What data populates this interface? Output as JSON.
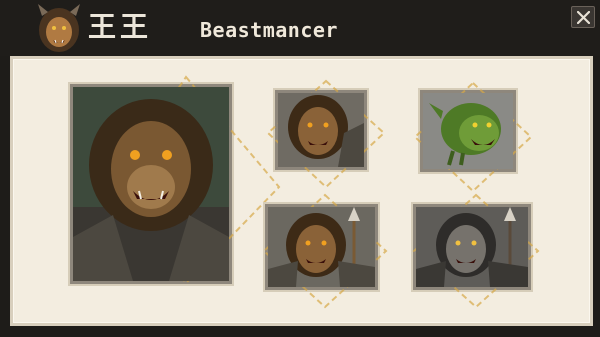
{
  "window": {
    "kanji": "王王",
    "title": "Beastmancer",
    "close_symbol": "✕"
  },
  "header_icon": "lion-warrior-portrait-icon",
  "cards": [
    {
      "name": "lion-warrior-large-portrait",
      "tint": "#3d4a3c",
      "fur": "#5a4126"
    },
    {
      "name": "lion-warrior-portrait",
      "tint": "#6f6b63",
      "fur": "#5b3f24"
    },
    {
      "name": "green-beast-portrait",
      "tint": "#8a8a86",
      "fur": "#5c8a2e"
    },
    {
      "name": "lion-spearman-portrait",
      "tint": "#6b6860",
      "fur": "#6a4a28"
    },
    {
      "name": "grey-wolf-spearman-portrait",
      "tint": "#5e5c58",
      "fur": "#55524f"
    }
  ],
  "colors": {
    "titlebar": "#1f1d1a",
    "panel": "#f3ede0",
    "accent_gold": "#d6a847"
  }
}
